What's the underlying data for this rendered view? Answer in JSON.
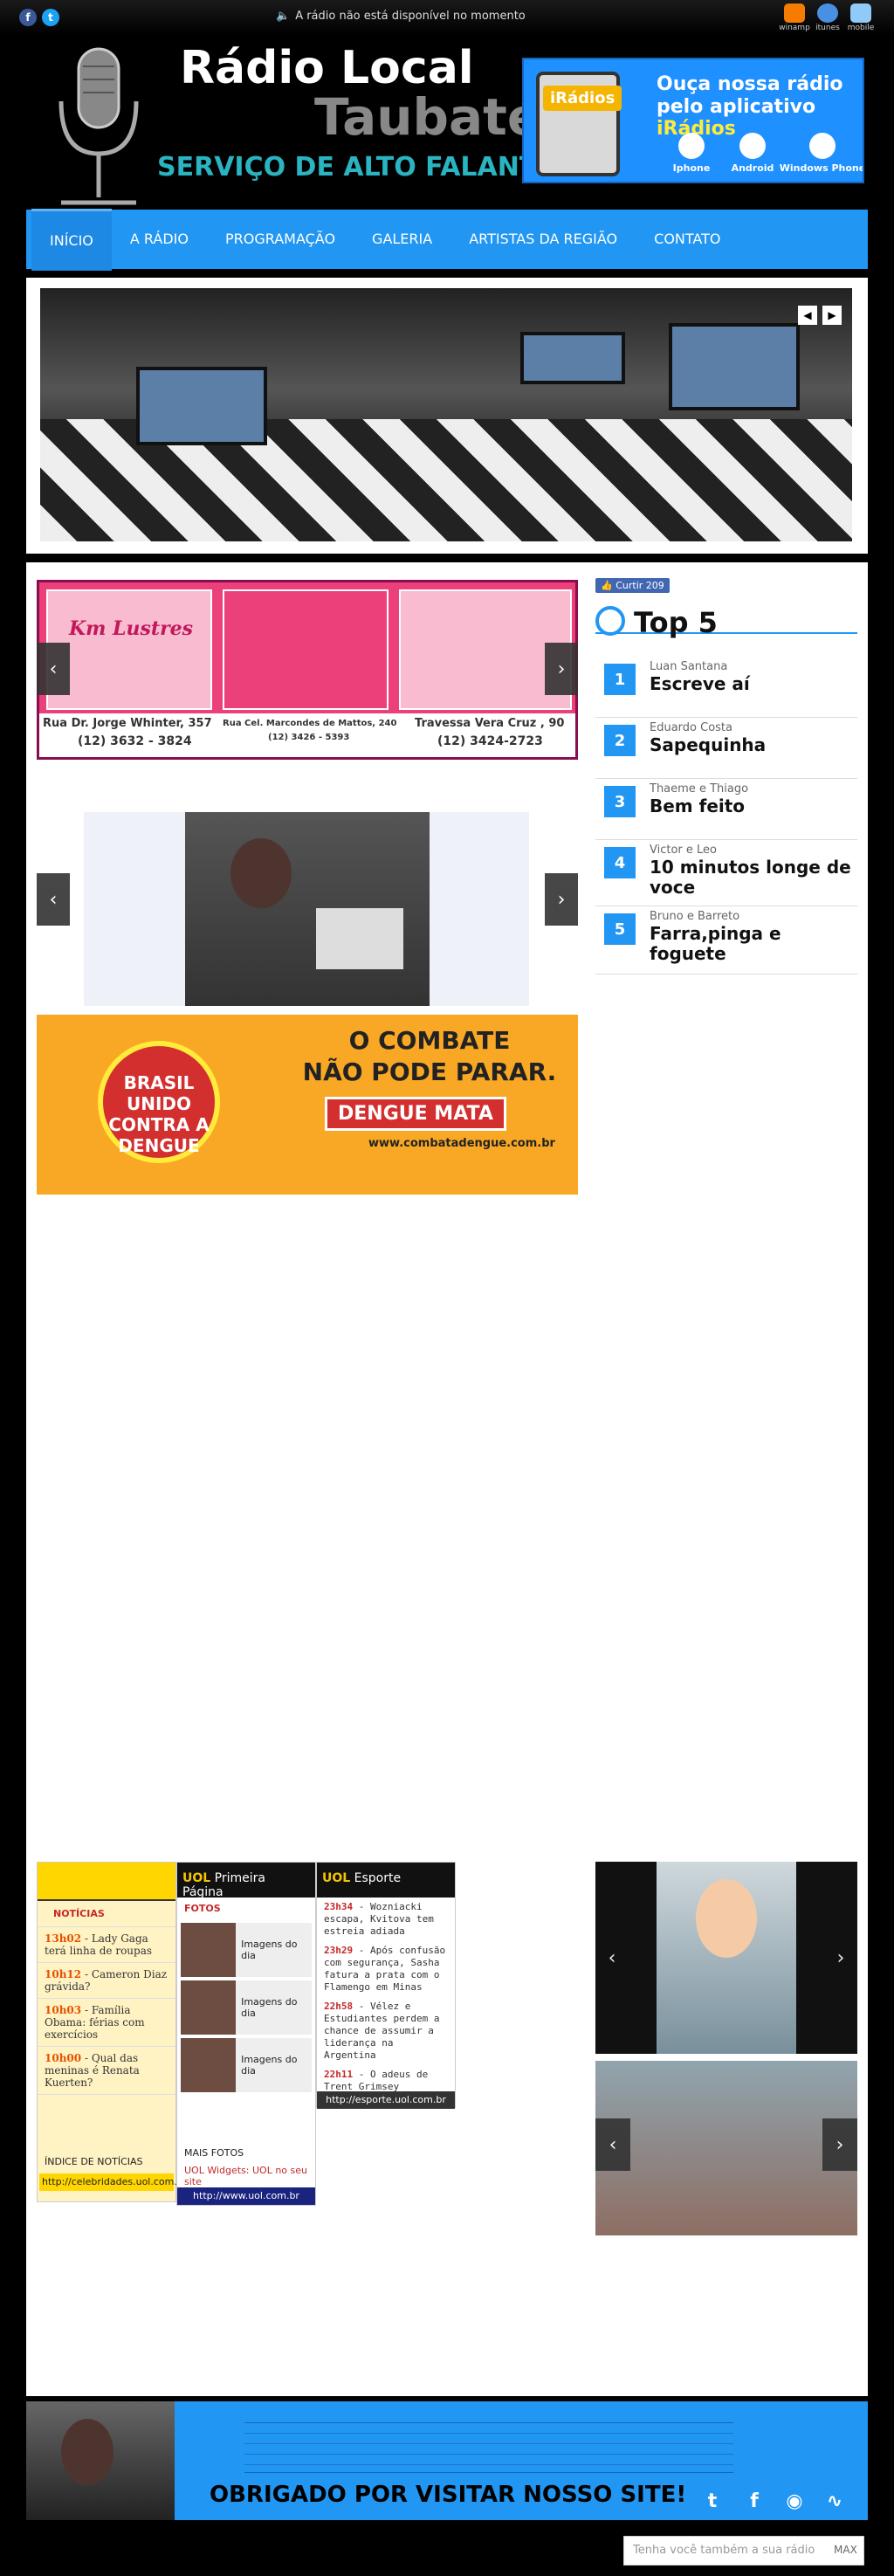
{
  "topbar": {
    "status": "A rádio não está disponível no momento",
    "players": [
      {
        "label": "winamp",
        "color": "#f57c00"
      },
      {
        "label": "itunes",
        "color": "#4a90e2"
      },
      {
        "label": "mobile",
        "color": "#90caf9"
      }
    ]
  },
  "header": {
    "title1": "Rádio Local",
    "title2": "Taubaté",
    "title3": "SERVIÇO DE ALTO FALANTE",
    "app_ad": {
      "logo": "iRádios",
      "line1": "Ouça nossa rádio",
      "line2a": "pelo aplicativo ",
      "line2b": "iRádios",
      "platforms": [
        "Iphone",
        "Android",
        "Windows Phone"
      ]
    }
  },
  "nav": [
    "INÍCIO",
    "A RÁDIO",
    "PROGRAMAÇÃO",
    "GALERIA",
    "ARTISTAS DA REGIÃO",
    "CONTATO"
  ],
  "ad_lustres": {
    "logo": "Km Lustres",
    "addr1": "Rua Dr. Jorge Whinter, 357",
    "phone1": "(12) 3632 - 3824",
    "addr2": "Rua Cel. Marcondes de Mattos, 240",
    "phone2": "(12) 3426 - 5393",
    "addr3": "Travessa Vera Cruz , 90",
    "phone3": "(12) 3424-2723"
  },
  "dengue": {
    "seal": "BRASIL UNIDO CONTRA A DENGUE",
    "headline1": "O COMBATE",
    "headline2": "NÃO PODE PARAR.",
    "tag": "DENGUE MATA",
    "url": "www.combatadengue.com.br"
  },
  "like": {
    "label": "Curtir",
    "count": "209"
  },
  "top5": {
    "title": "Top 5",
    "items": [
      {
        "n": "1",
        "artist": "Luan Santana",
        "song": "Escreve aí"
      },
      {
        "n": "2",
        "artist": "Eduardo Costa",
        "song": "Sapequinha"
      },
      {
        "n": "3",
        "artist": "Thaeme e Thiago",
        "song": "Bem feito"
      },
      {
        "n": "4",
        "artist": "Victor e Leo",
        "song": "10 minutos longe de voce"
      },
      {
        "n": "5",
        "artist": "Bruno e Barreto",
        "song": "Farra,pinga e foguete"
      }
    ]
  },
  "widget_news": {
    "section": "NOTÍCIAS",
    "items": [
      {
        "time": "13h02",
        "text": "Lady Gaga terá linha de roupas"
      },
      {
        "time": "10h12",
        "text": "Cameron Diaz grávida?"
      },
      {
        "time": "10h03",
        "text": "Família Obama: férias com exercícios"
      },
      {
        "time": "10h00",
        "text": "Qual das meninas é Renata Kuerten?"
      }
    ],
    "index": "ÍNDICE DE NOTÍCIAS",
    "footer": "http://celebridades.uol.com.br"
  },
  "widget_uol": {
    "brand": "UOL",
    "title": "Primeira Página",
    "fotos": "FOTOS",
    "photo_label": "Imagens do dia",
    "more": "MAIS FOTOS",
    "link": "UOL Widgets: UOL no seu site",
    "footer": "http://www.uol.com.br"
  },
  "widget_esporte": {
    "brand": "UOL",
    "title": "Esporte",
    "items": [
      {
        "time": "23h34",
        "text": "Wozniacki escapa, Kvitova tem estreia adiada"
      },
      {
        "time": "23h29",
        "text": "Após confusão com segurança, Sasha fatura a prata com o Flamengo em Minas"
      },
      {
        "time": "22h58",
        "text": "Vélez e Estudiantes perdem a chance de assumir a liderança na Argentina"
      },
      {
        "time": "22h11",
        "text": "O adeus de Trent Grimsey"
      }
    ],
    "footer": "http://esporte.uol.com.br"
  },
  "footer": {
    "thanks": "OBRIGADO POR VISITAR NOSSO SITE!",
    "search_placeholder": "Tenha você também a sua rádio",
    "search_brand": "MAX"
  }
}
